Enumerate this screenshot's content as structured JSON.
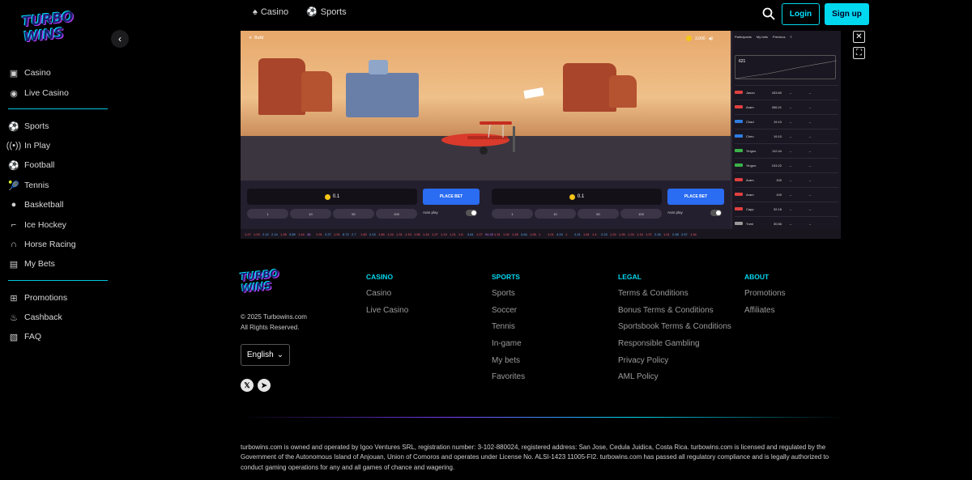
{
  "brand": {
    "logo_text": "TURBO WINS"
  },
  "sidebar": {
    "items": [
      {
        "label": "Casino",
        "icon": "casino-icon"
      },
      {
        "label": "Live Casino",
        "icon": "live-casino-icon"
      },
      {
        "label": "Sports",
        "icon": "sports-icon"
      },
      {
        "label": "In Play",
        "icon": "in-play-icon"
      },
      {
        "label": "Football",
        "icon": "football-icon"
      },
      {
        "label": "Tennis",
        "icon": "tennis-icon"
      },
      {
        "label": "Basketball",
        "icon": "basketball-icon"
      },
      {
        "label": "Ice Hockey",
        "icon": "ice-hockey-icon"
      },
      {
        "label": "Horse Racing",
        "icon": "horse-racing-icon"
      },
      {
        "label": "My Bets",
        "icon": "my-bets-icon"
      },
      {
        "label": "Promotions",
        "icon": "gift-icon"
      },
      {
        "label": "Cashback",
        "icon": "cashback-icon"
      },
      {
        "label": "FAQ",
        "icon": "faq-icon"
      }
    ]
  },
  "topnav": {
    "casino": "Casino",
    "sports": "Sports",
    "login": "Login",
    "signup": "Sign up"
  },
  "game": {
    "build_label": "Build",
    "balance": "3,000",
    "bet_amount": "0.1",
    "place_bet": "PLACE BET",
    "chips": [
      "1",
      "10",
      "50",
      "100"
    ],
    "autoplay": "Auto play",
    "tabs": [
      "Participants",
      "My bets",
      "Previous"
    ],
    "round_count": "621",
    "participants": [
      {
        "name": "Jason",
        "amount": "433.60",
        "color": "#e04040"
      },
      {
        "name": "Aram",
        "amount": "266.21",
        "color": "#e04040"
      },
      {
        "name": "Chad",
        "amount": "19.10",
        "color": "#2f7de1"
      },
      {
        "name": "Cheo",
        "amount": "19.10",
        "color": "#2f7de1"
      },
      {
        "name": "Yingno",
        "amount": "112.44",
        "color": "#3bb34a"
      },
      {
        "name": "Yingno",
        "amount": "103.22",
        "color": "#3bb34a"
      },
      {
        "name": "Aram",
        "amount": "100",
        "color": "#e04040"
      },
      {
        "name": "Aram",
        "amount": "100",
        "color": "#e04040"
      },
      {
        "name": "Capp",
        "amount": "32.16",
        "color": "#e04040"
      },
      {
        "name": "Yumi",
        "amount": "30.66",
        "color": "#999999"
      }
    ],
    "history": [
      "1.27",
      "1.03",
      "2.12",
      "2.14",
      "1.28",
      "3.89",
      "1.44",
      "36",
      "1.91",
      "2.27",
      "1.91",
      "8.72",
      "2.7",
      "1.82",
      "2.13",
      "1.89",
      "1.24",
      "1.31",
      "1.19",
      "1.55",
      "1.16",
      "1.27",
      "1.13",
      "1.21",
      "1.6",
      "3.61",
      "1.27",
      "54.33",
      "1.31",
      "1.32",
      "1.28",
      "3.64",
      "1.05",
      "1",
      "1.01",
      "4.24",
      "1",
      "2.21",
      "1.81",
      "1.4",
      "2.23",
      "1.22",
      "1.26",
      "1.24",
      "1.15",
      "1.37",
      "2.16",
      "1.41",
      "2.08",
      "2.57",
      "1.34"
    ]
  },
  "footer": {
    "copyright_1": "© 2025 Turbowins.com",
    "copyright_2": "All Rights Reserved.",
    "language": "English",
    "columns": [
      {
        "title": "CASINO",
        "links": [
          "Casino",
          "Live Casino"
        ]
      },
      {
        "title": "SPORTS",
        "links": [
          "Sports",
          "Soccer",
          "Tennis",
          "In-game",
          "My bets",
          "Favorites"
        ]
      },
      {
        "title": "LEGAL",
        "links": [
          "Terms & Conditions",
          "Bonus Terms & Conditions",
          "Sportsbook Terms & Conditions",
          "Responsible Gambling",
          "Privacy Policy",
          "AML Policy"
        ]
      },
      {
        "title": "ABOUT",
        "links": [
          "Promotions",
          "Affiliates"
        ]
      }
    ],
    "legal_text": "turbowins.com is owned and operated by Igoo Ventures SRL, registration number: 3-102-880024, registered address: San Jose, Cedula Juidica, Costa Rica. turbowins.com is licensed and regulated by the Government of the Autonomous Island of Anjouan, Union of Comoros and operates under License No. ALSI-1423 11005-FI2. turbowins.com has passed all regulatory compliance and is legally authorized to conduct gaming operations for any and all games of chance and wagering."
  }
}
